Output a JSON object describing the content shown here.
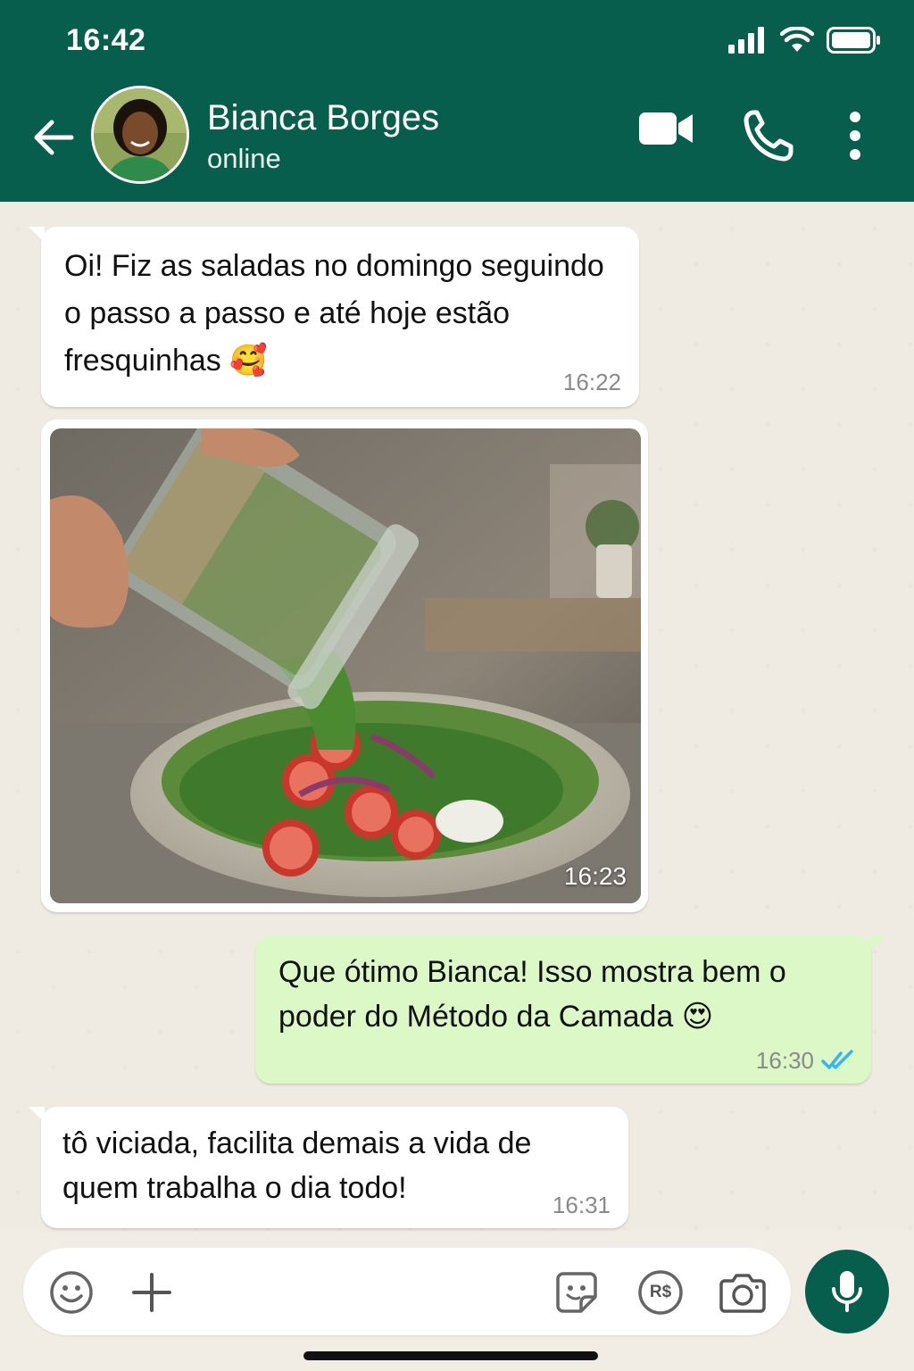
{
  "status_bar": {
    "time": "16:42"
  },
  "header": {
    "contact_name": "Bianca Borges",
    "contact_status": "online",
    "icons": [
      "back-arrow-icon",
      "video-call-icon",
      "phone-icon",
      "more-vert-icon"
    ]
  },
  "messages": [
    {
      "direction": "in",
      "type": "text",
      "text": "Oi! Fiz as saladas no domingo seguindo o passo a passo e até hoje estão fresquinhas 🥰",
      "time": "16:22"
    },
    {
      "direction": "in",
      "type": "image",
      "description_icon": "salad-photo",
      "time": "16:23"
    },
    {
      "direction": "out",
      "type": "text",
      "text": "Que ótimo Bianca! Isso mostra bem o poder do Método da Camada 😍",
      "time": "16:30",
      "status": "read"
    },
    {
      "direction": "in",
      "type": "text",
      "text": "tô viciada, facilita demais a vida de quem trabalha o dia todo!",
      "time": "16:31"
    }
  ],
  "input_bar": {
    "icons": [
      "emoji-icon",
      "plus-icon",
      "sticker-icon",
      "payment-icon",
      "camera-icon",
      "mic-icon"
    ],
    "payment_label": "R$"
  },
  "colors": {
    "header": "#075e4c",
    "outgoing_bubble": "#dcf8c6",
    "incoming_bubble": "#ffffff",
    "read_ticks": "#34b7f1",
    "chat_bg": "#efeae2"
  }
}
